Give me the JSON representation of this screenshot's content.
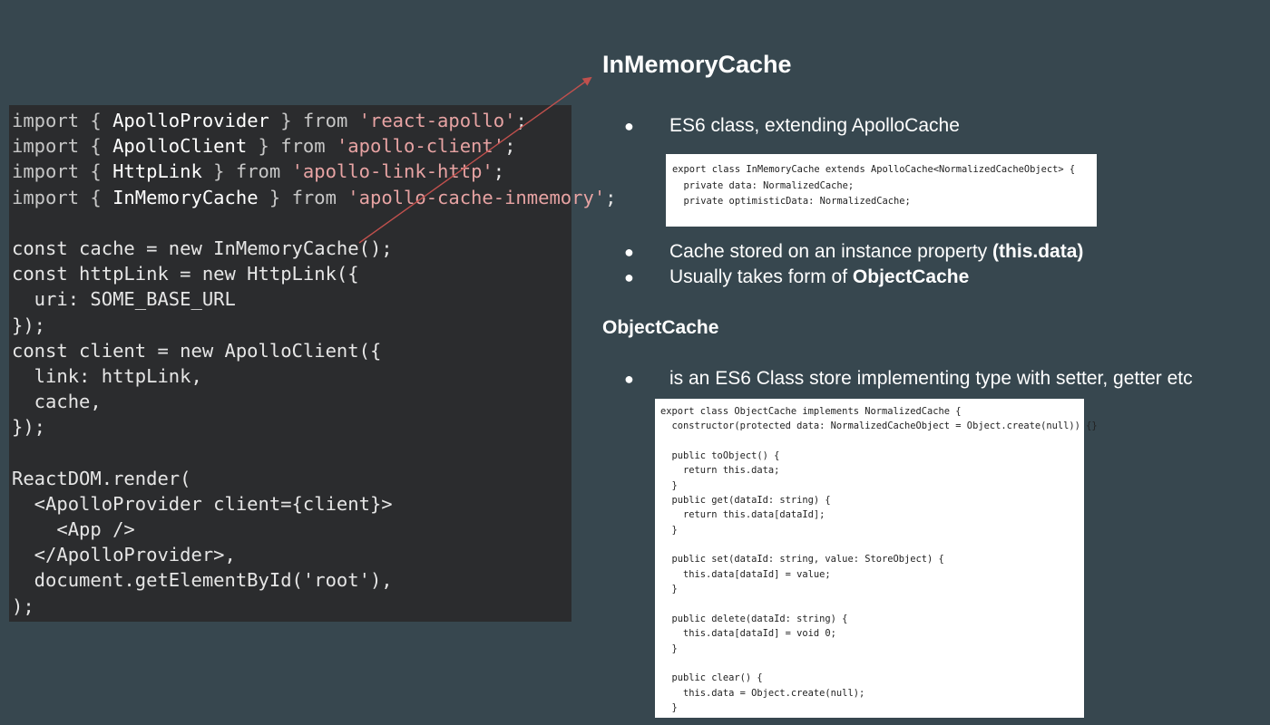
{
  "left_code": {
    "lines": [
      [
        "import { ",
        "ApolloProvider",
        " } from ",
        "'react-apollo'",
        ";"
      ],
      [
        "import { ",
        "ApolloClient",
        " } from ",
        "'apollo-client'",
        ";"
      ],
      [
        "import { ",
        "HttpLink",
        " } from ",
        "'apollo-link-http'",
        ";"
      ],
      [
        "import { ",
        "InMemoryCache",
        " } from ",
        "'apollo-cache-inmemory'",
        ";"
      ],
      "",
      "const cache = new InMemoryCache();",
      "const httpLink = new HttpLink({",
      "  uri: SOME_BASE_URL",
      "});",
      "const client = new ApolloClient({",
      "  link: httpLink,",
      "  cache,",
      "});",
      "",
      "ReactDOM.render(",
      "  <ApolloProvider client={client}>",
      "    <App />",
      "  </ApolloProvider>,",
      "  document.getElementById('root'),",
      ");"
    ]
  },
  "heading_main": "InMemoryCache",
  "bullets_top": [
    {
      "text": "ES6 class, extending ApolloCache",
      "bold": ""
    },
    {
      "text": "Cache stored on an instance property ",
      "bold": "(this.data)"
    },
    {
      "text": "Usually takes form of ",
      "bold": "ObjectCache"
    }
  ],
  "code_snippet_1": [
    "export class InMemoryCache extends ApolloCache<NormalizedCacheObject> {",
    "  private data: NormalizedCache;",
    "  private optimisticData: NormalizedCache;"
  ],
  "heading_secondary": "ObjectCache",
  "bullets_bottom": [
    {
      "text": "is an ES6 Class store implementing type with setter, getter etc",
      "bold": ""
    }
  ],
  "code_snippet_2": [
    "export class ObjectCache implements NormalizedCache {",
    "  constructor(protected data: NormalizedCacheObject = Object.create(null)) {}",
    "",
    "  public toObject() {",
    "    return this.data;",
    "  }",
    "  public get(dataId: string) {",
    "    return this.data[dataId];",
    "  }",
    "",
    "  public set(dataId: string, value: StoreObject) {",
    "    this.data[dataId] = value;",
    "  }",
    "",
    "  public delete(dataId: string) {",
    "    this.data[dataId] = void 0;",
    "  }",
    "",
    "  public clear() {",
    "    this.data = Object.create(null);",
    "  }"
  ],
  "colors": {
    "background": "#37474f",
    "code_bg": "#2b2c2e",
    "arrow": "#c0504d"
  }
}
